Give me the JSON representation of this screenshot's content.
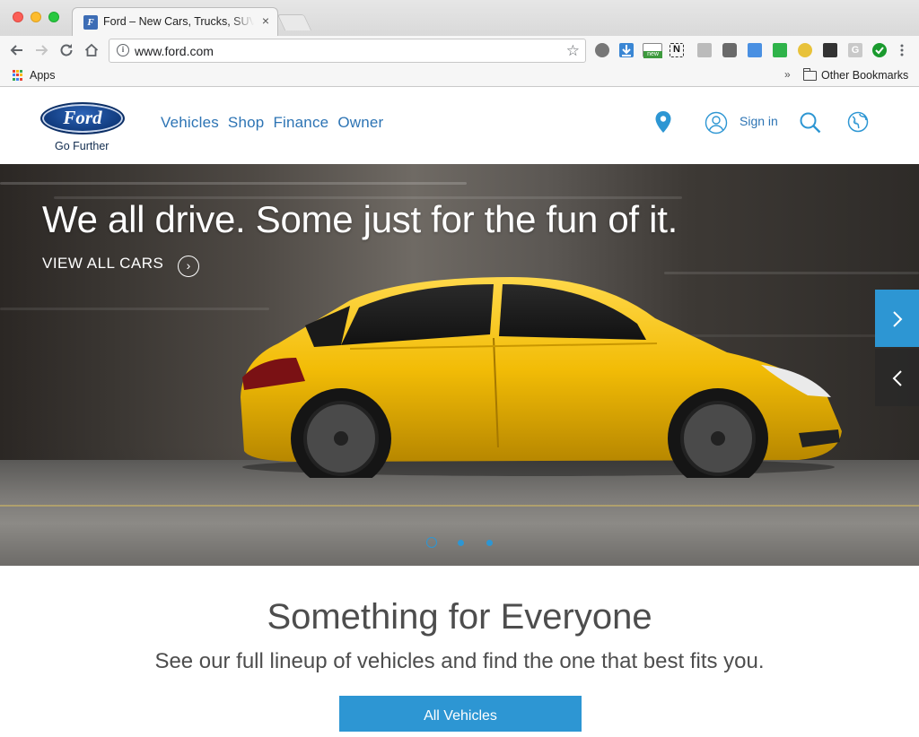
{
  "browser": {
    "tab_title": "Ford – New Cars, Trucks, SUVs",
    "tab_favicon": "F",
    "close_symbol": "×",
    "url": "www.ford.com",
    "apps_label": "Apps",
    "chevron_symbol": "»",
    "other_bookmarks": "Other Bookmarks",
    "extension_new_badge": "new",
    "extension_n_label": "N",
    "extension_g_label": "G"
  },
  "site": {
    "logo_text": "Ford",
    "tagline": "Go Further",
    "nav": [
      "Vehicles",
      "Shop",
      "Finance",
      "Owner"
    ],
    "signin": "Sign in"
  },
  "hero": {
    "title": "We all drive. Some just for the fun of it.",
    "cta": "VIEW ALL CARS",
    "slide_count": 3,
    "active_slide": 1
  },
  "content": {
    "title": "Something for Everyone",
    "subtitle": "See our full lineup of vehicles and find the one that best fits you.",
    "button": "All Vehicles"
  },
  "colors": {
    "ford_blue": "#2d74b4",
    "accent_blue": "#2d96d3",
    "car_yellow": "#f2c200"
  }
}
